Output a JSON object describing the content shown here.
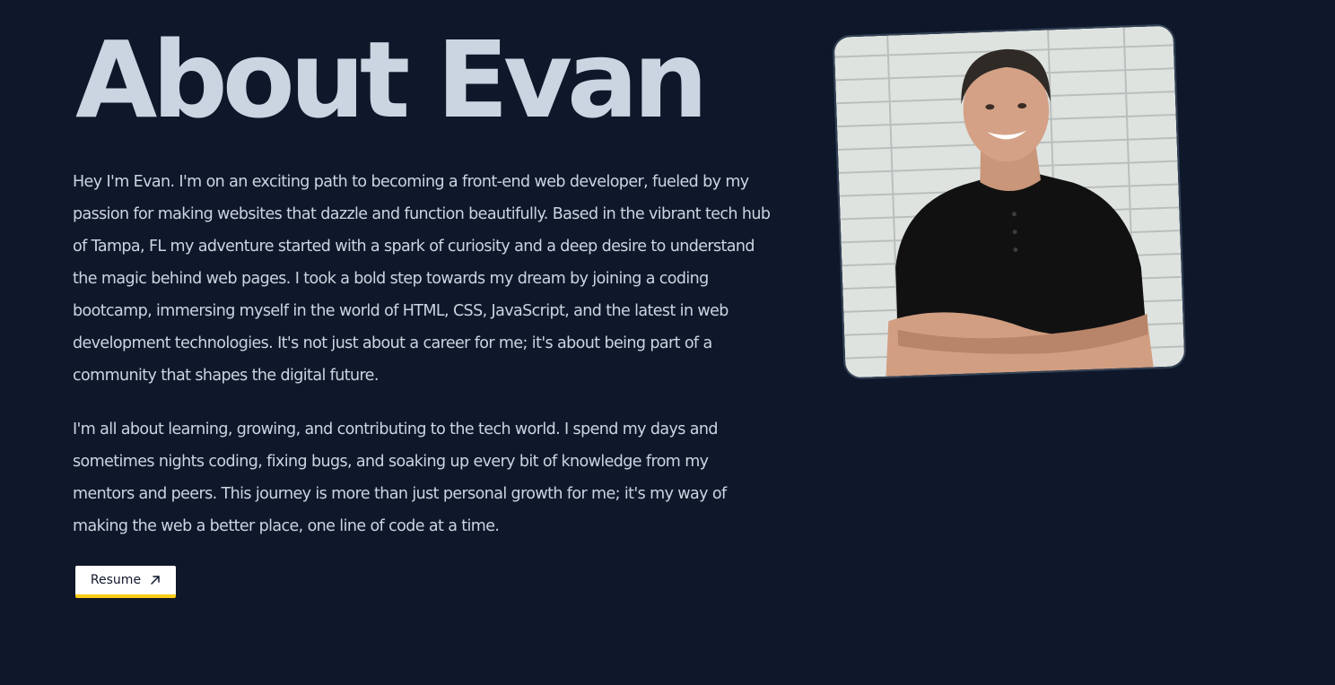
{
  "page": {
    "title": "About Evan"
  },
  "bio": {
    "paragraphs": [
      "Hey I'm Evan. I'm on an exciting path to becoming a front-end web developer, fueled by my passion for making websites that dazzle and function beautifully. Based in the vibrant tech hub of Tampa, FL my adventure started with a spark of curiosity and a deep desire to understand the magic behind web pages. I took a bold step towards my dream by joining a coding bootcamp, immersing myself in the world of HTML, CSS, JavaScript, and the latest in web development technologies. It's not just about a career for me; it's about being part of a community that shapes the digital future.",
      "I'm all about learning, growing, and contributing to the tech world. I spend my days and sometimes nights coding, fixing bugs, and soaking up every bit of knowledge from my mentors and peers. This journey is more than just personal growth for me; it's my way of making the web a better place, one line of code at a time."
    ]
  },
  "resume": {
    "label": "Resume",
    "icon": "arrow-up-right-icon"
  },
  "colors": {
    "background": "#0f172a",
    "text": "#cbd5e1",
    "button_bg": "#ffffff",
    "button_accent": "#facc15"
  }
}
